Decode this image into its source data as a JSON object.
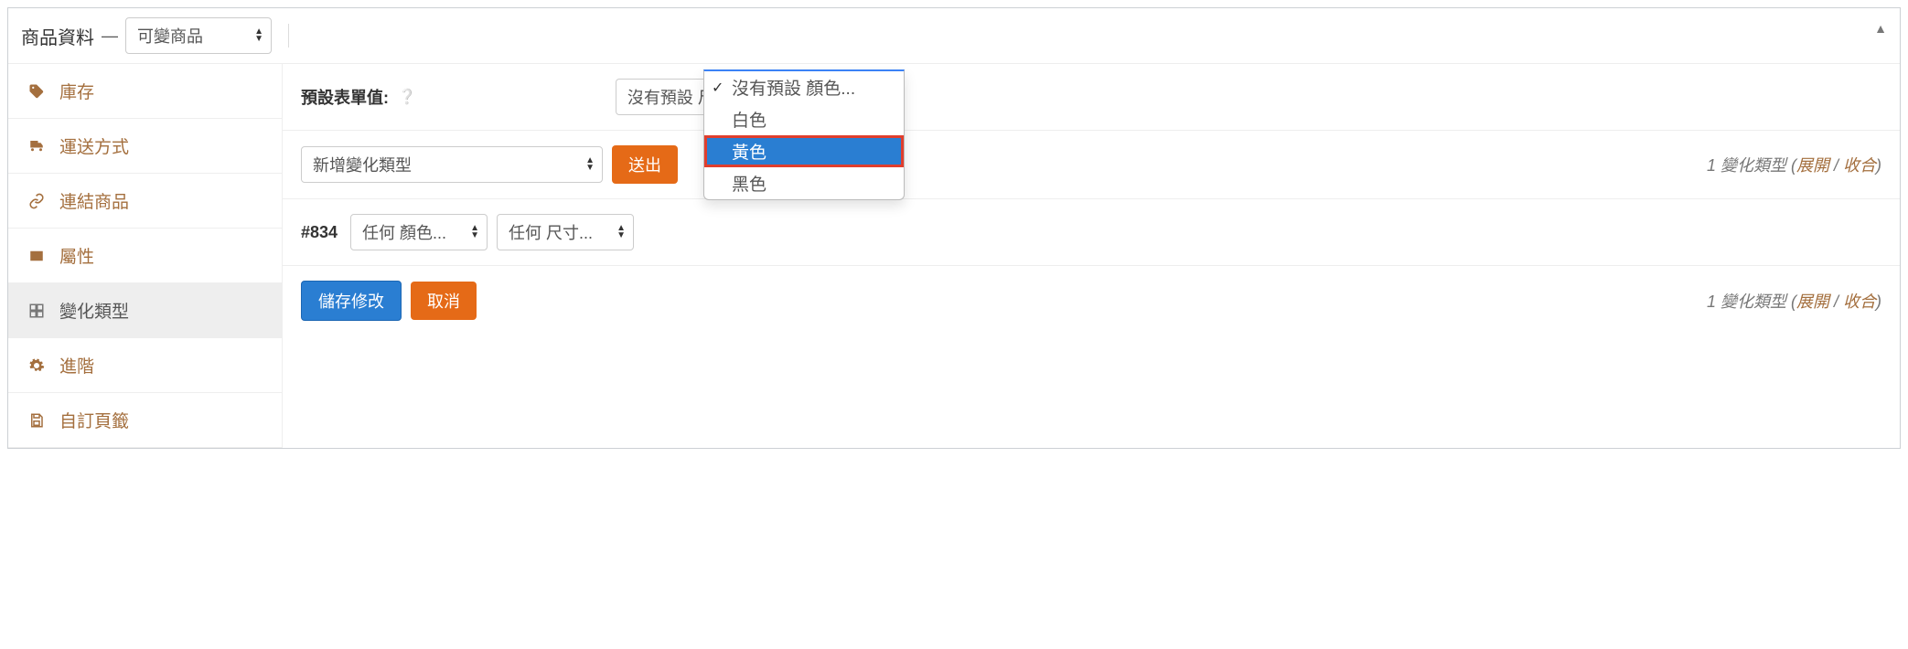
{
  "header": {
    "title": "商品資料",
    "type_select": "可變商品"
  },
  "sidebar": {
    "items": [
      {
        "label": "庫存",
        "icon": "tag-icon"
      },
      {
        "label": "運送方式",
        "icon": "truck-icon"
      },
      {
        "label": "連結商品",
        "icon": "link-icon"
      },
      {
        "label": "屬性",
        "icon": "id-icon"
      },
      {
        "label": "變化類型",
        "icon": "grid-icon",
        "active": true
      },
      {
        "label": "進階",
        "icon": "gear-icon"
      },
      {
        "label": "自訂頁籤",
        "icon": "save-icon"
      }
    ]
  },
  "defaults": {
    "label": "預設表單值:",
    "color_select_placeholder": "沒有預設 顏色...",
    "size_select_placeholder": "沒有預設 尺寸...",
    "dropdown_options": [
      "沒有預設 顏色...",
      "白色",
      "黃色",
      "黑色"
    ],
    "dropdown_selected_index": 0,
    "dropdown_highlight_index": 2
  },
  "add_variation": {
    "select_label": "新增變化類型",
    "submit": "送出"
  },
  "summary": {
    "count_label": "1 變化類型",
    "expand": "展開",
    "collapse": "收合"
  },
  "variation": {
    "id": "#834",
    "color_any": "任何 顏色...",
    "size_any": "任何 尺寸..."
  },
  "actions": {
    "save": "儲存修改",
    "cancel": "取消"
  }
}
